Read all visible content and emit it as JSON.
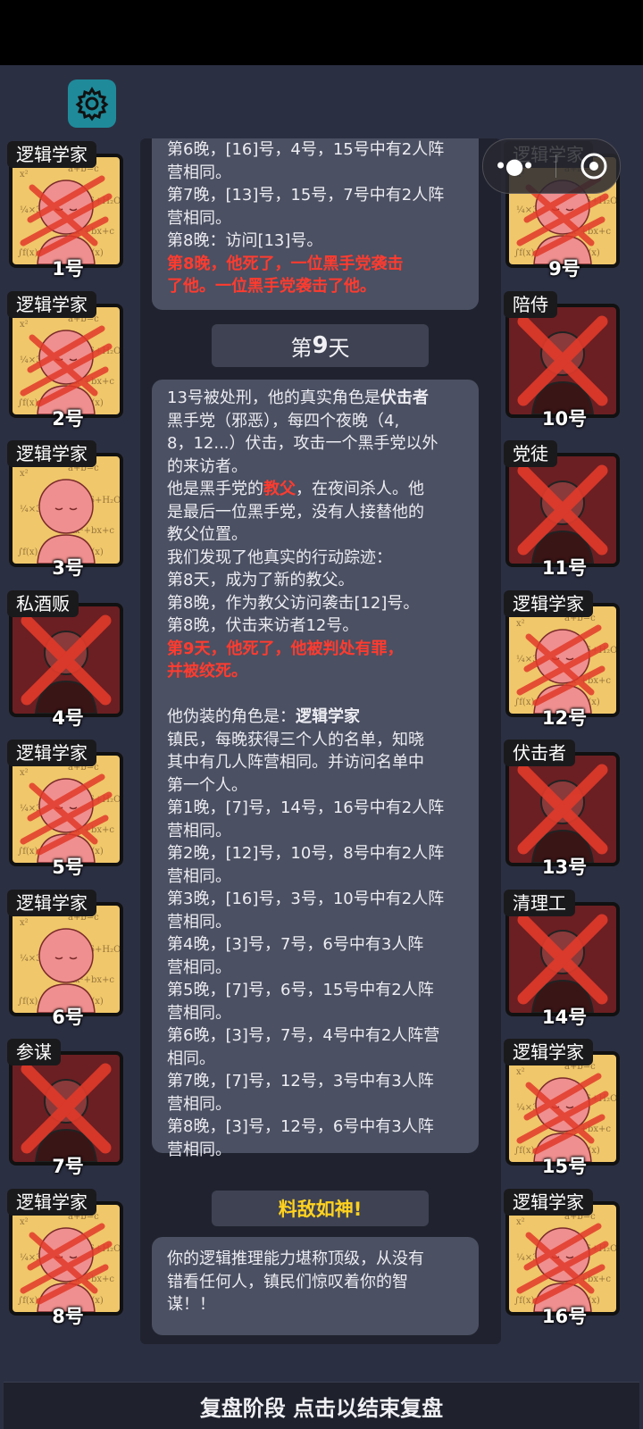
{
  "log_top": {
    "lines": [
      {
        "text": "第6晚，[16]号，4号，15号中有2人阵"
      },
      {
        "text": "营相同。"
      },
      {
        "text": "第7晚，[13]号，15号，7号中有2人阵"
      },
      {
        "text": "营相同。"
      },
      {
        "text": "第8晚：访问[13]号。"
      },
      {
        "text": "第8晚，他死了，一位黑手党袭击",
        "hl": true
      },
      {
        "text": "了他。一位黑手党袭击了他。",
        "hl": true
      }
    ]
  },
  "day": {
    "prefix": "第",
    "number": "9",
    "suffix": "天"
  },
  "log_main": {
    "l1_a": "13号被处刑，他的真实角色是",
    "l1_b": "伏击者",
    "l2": "黑手党（邪恶），每四个夜晚（4,",
    "l3": "8，12...）伏击，攻击一个黑手党以外",
    "l4": "的来访者。",
    "l5_a": "他是黑手党的",
    "l5_b": "教父",
    "l5_c": "，在夜间杀人。他",
    "l6": "是最后一位黑手党，没有人接替他的",
    "l7": "教父位置。",
    "l8": "我们发现了他真实的行动踪迹：",
    "l9": "第8天，成为了新的教父。",
    "l10": "第8晚，作为教父访问袭击[12]号。",
    "l11": "第8晚，伏击来访者12号。",
    "l12": "第9天，他死了，他被判处有罪，",
    "l13": "并被绞死。",
    "l14_a": "他伪装的角色是：",
    "l14_b": "逻辑学家",
    "l15": "镇民，每晚获得三个人的名单，知晓",
    "l16": "其中有几人阵营相同。并访问名单中",
    "l17": "第一个人。",
    "l18": "第1晚，[7]号，14号，16号中有2人阵",
    "l19": "营相同。",
    "l20": "第2晚，[12]号，10号，8号中有2人阵",
    "l21": "营相同。",
    "l22": "第3晚，[16]号，3号，10号中有2人阵",
    "l23": "营相同。",
    "l24": "第4晚，[3]号，7号，6号中有3人阵",
    "l25": "营相同。",
    "l26": "第5晚，[7]号，6号，15号中有2人阵",
    "l27": "营相同。",
    "l28": "第6晚，[3]号，7号，4号中有2人阵营",
    "l29": "相同。",
    "l30": "第7晚，[7]号，12号，3号中有3人阵",
    "l31": "营相同。",
    "l32": "第8晚，[3]号，12号，6号中有3人阵",
    "l33": "营相同。"
  },
  "verdict": "料敌如神!",
  "log_end": {
    "l1": "你的逻辑推理能力堪称顶级，从没有",
    "l2": "错看任何人，镇民们惊叹着你的智",
    "l3": "谋！！"
  },
  "players_left": [
    {
      "role": "逻辑学家",
      "num": "1号",
      "style": "logic",
      "crossed": true
    },
    {
      "role": "逻辑学家",
      "num": "2号",
      "style": "logic",
      "crossed": true
    },
    {
      "role": "逻辑学家",
      "num": "3号",
      "style": "logic",
      "crossed": false
    },
    {
      "role": "私酒贩",
      "num": "4号",
      "style": "dark",
      "crossed": true
    },
    {
      "role": "逻辑学家",
      "num": "5号",
      "style": "logic",
      "crossed": true
    },
    {
      "role": "逻辑学家",
      "num": "6号",
      "style": "logic",
      "crossed": false
    },
    {
      "role": "参谋",
      "num": "7号",
      "style": "dark",
      "crossed": true
    },
    {
      "role": "逻辑学家",
      "num": "8号",
      "style": "logic",
      "crossed": true
    }
  ],
  "players_right": [
    {
      "role": "逻辑学家",
      "num": "9号",
      "style": "logic",
      "crossed": true
    },
    {
      "role": "陪侍",
      "num": "10号",
      "style": "dark",
      "crossed": true
    },
    {
      "role": "党徒",
      "num": "11号",
      "style": "dark",
      "crossed": true
    },
    {
      "role": "逻辑学家",
      "num": "12号",
      "style": "logic",
      "crossed": true
    },
    {
      "role": "伏击者",
      "num": "13号",
      "style": "dark",
      "crossed": true
    },
    {
      "role": "清理工",
      "num": "14号",
      "style": "dark",
      "crossed": true
    },
    {
      "role": "逻辑学家",
      "num": "15号",
      "style": "logic",
      "crossed": true
    },
    {
      "role": "逻辑学家",
      "num": "16号",
      "style": "logic",
      "crossed": true
    }
  ],
  "bottom_bar": "复盘阶段 点击以结束复盘",
  "icons": {
    "settings": "gear-icon",
    "menu": "more-dots-icon",
    "close": "target-close-icon"
  },
  "colors": {
    "highlight": "#ff3b2f",
    "verdict": "#ffd21f",
    "settings_bg": "#1f8a9a"
  }
}
